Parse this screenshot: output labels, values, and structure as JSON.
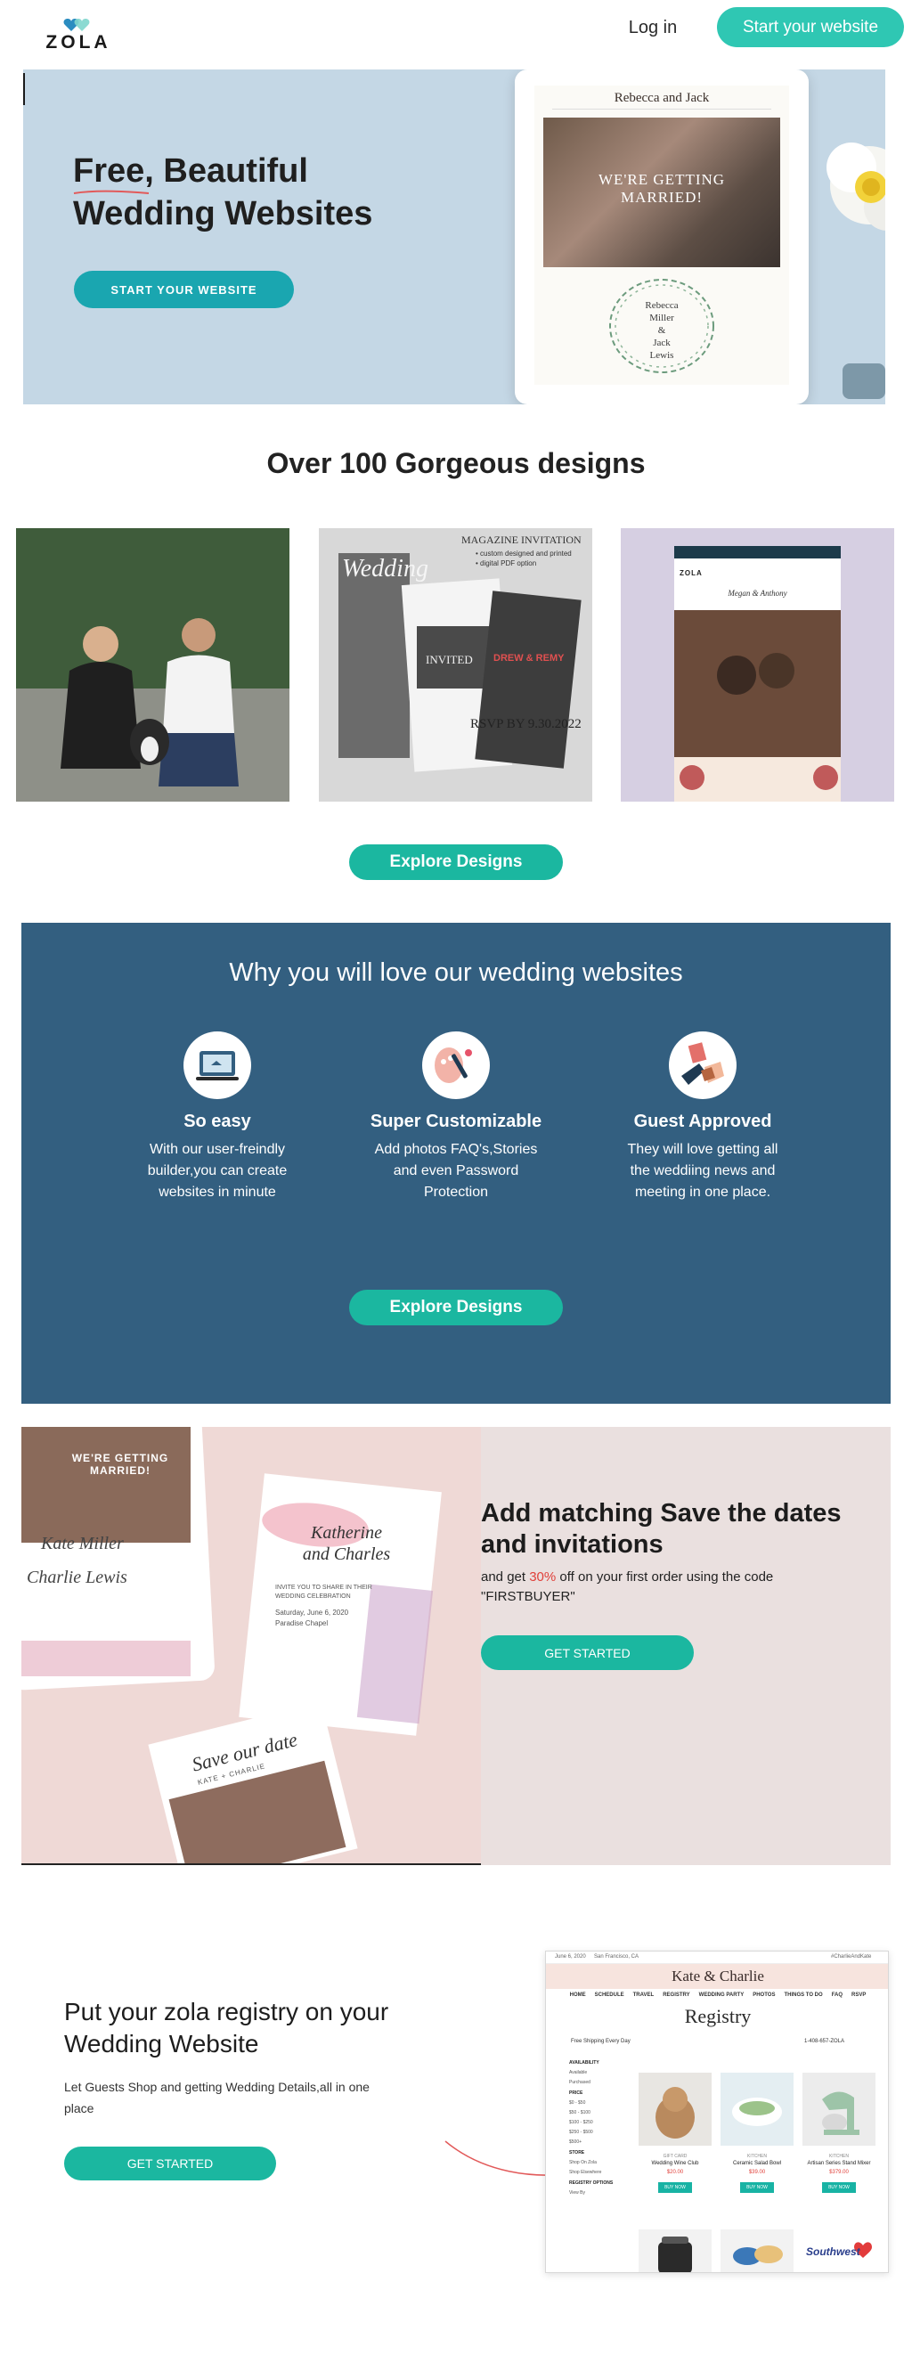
{
  "header": {
    "logo_text": "ZOLA",
    "login": "Log in",
    "cta": "Start your website"
  },
  "hero": {
    "title_line1": "Free, Beautiful",
    "title_line2": "Wedding Websites",
    "button": "START YOUR WEBSITE",
    "tablet": {
      "names": "Rebecca and Jack",
      "headline_line1": "WE'RE GETTING",
      "headline_line2": "MARRIED!",
      "wreath_line1": "Rebecca",
      "wreath_line2": "Miller",
      "wreath_line3": "&",
      "wreath_line4": "Jack",
      "wreath_line5": "Lewis"
    }
  },
  "designs": {
    "title": "Over 100 Gorgeous designs",
    "card2": {
      "label": "MAGAZINE INVITATION",
      "bullet1": "• custom designed and printed",
      "bullet2": "• digital PDF option",
      "rsvp": "RSVP BY 9.30.2022",
      "mag_title": "Wedding",
      "couple": "DREW & REMY",
      "invited": "INVITED"
    },
    "card3": {
      "logo": "ZOLA",
      "names": "Megan & Anthony"
    },
    "explore": "Explore Designs"
  },
  "why": {
    "title": "Why you will love our wedding websites",
    "features": [
      {
        "title": "So easy",
        "desc": "With our user-freindly builder,you can create websites in minute"
      },
      {
        "title": "Super Customizable",
        "desc": "Add photos FAQ's,Stories and even Password Protection"
      },
      {
        "title": "Guest Approved",
        "desc": "They will love getting all the weddiing news and meeting in one place."
      }
    ],
    "explore": "Explore Designs"
  },
  "stationery": {
    "title": "Add matching Save the dates and invitations",
    "desc_before": "and get ",
    "desc_highlight": "30%",
    "desc_after": " off on your first order using the code \"FIRSTBUYER\"",
    "button": "GET STARTED",
    "tablet_headline": "WE'RE GETTING MARRIED!",
    "tablet_names1": "Kate Miller",
    "tablet_names2": "Charlie Lewis",
    "card_names1": "Katherine",
    "card_names2": "and Charles",
    "card_body": "INVITE YOU TO SHARE IN THEIR WEDDING CELEBRATION",
    "card_date": "Saturday, June 6, 2020",
    "card_place": "Paradise Chapel",
    "std_label": "Save our date",
    "std_names": "KATE + CHARLIE"
  },
  "registry": {
    "title": "Put your zola registry on your Wedding Website",
    "desc": "Let Guests Shop and getting Wedding Details,all in one place",
    "button": "GET STARTED",
    "screen": {
      "date": "June 6, 2020",
      "location": "San Francisco, CA",
      "hashtag": "#CharlieAndKate",
      "names": "Kate & Charlie",
      "nav": [
        "HOME",
        "SCHEDULE",
        "TRAVEL",
        "REGISTRY",
        "WEDDING PARTY",
        "PHOTOS",
        "THINGS TO DO",
        "FAQ",
        "RSVP"
      ],
      "heading": "Registry",
      "shipping": "Free Shipping Every Day",
      "help": "1-408-657-ZOLA",
      "sidebar": {
        "availability": "AVAILABILITY",
        "avail_items": [
          "Available",
          "Purchased"
        ],
        "price": "PRICE",
        "price_items": [
          "$0 - $50",
          "$50 - $100",
          "$100 - $250",
          "$250 - $500",
          "$500+"
        ],
        "stores": "STORE",
        "store_items": [
          "Shop On Zola",
          "Shop Elsewhere"
        ],
        "registry": "REGISTRY OPTIONS",
        "registry_items": [
          "View By"
        ]
      },
      "products": [
        {
          "cat": "GIFT CARD",
          "name": "Wedding Wine Club",
          "price": "$20.00",
          "buy": "BUY NOW"
        },
        {
          "cat": "KITCHEN",
          "name": "Ceramic Salad Bowl",
          "price": "$39.00",
          "buy": "BUY NOW"
        },
        {
          "cat": "KITCHEN",
          "name": "Artisan Series Stand Mixer",
          "price": "$379.00",
          "buy": "BUY NOW"
        }
      ],
      "bottom_brand": "Southwest"
    }
  }
}
